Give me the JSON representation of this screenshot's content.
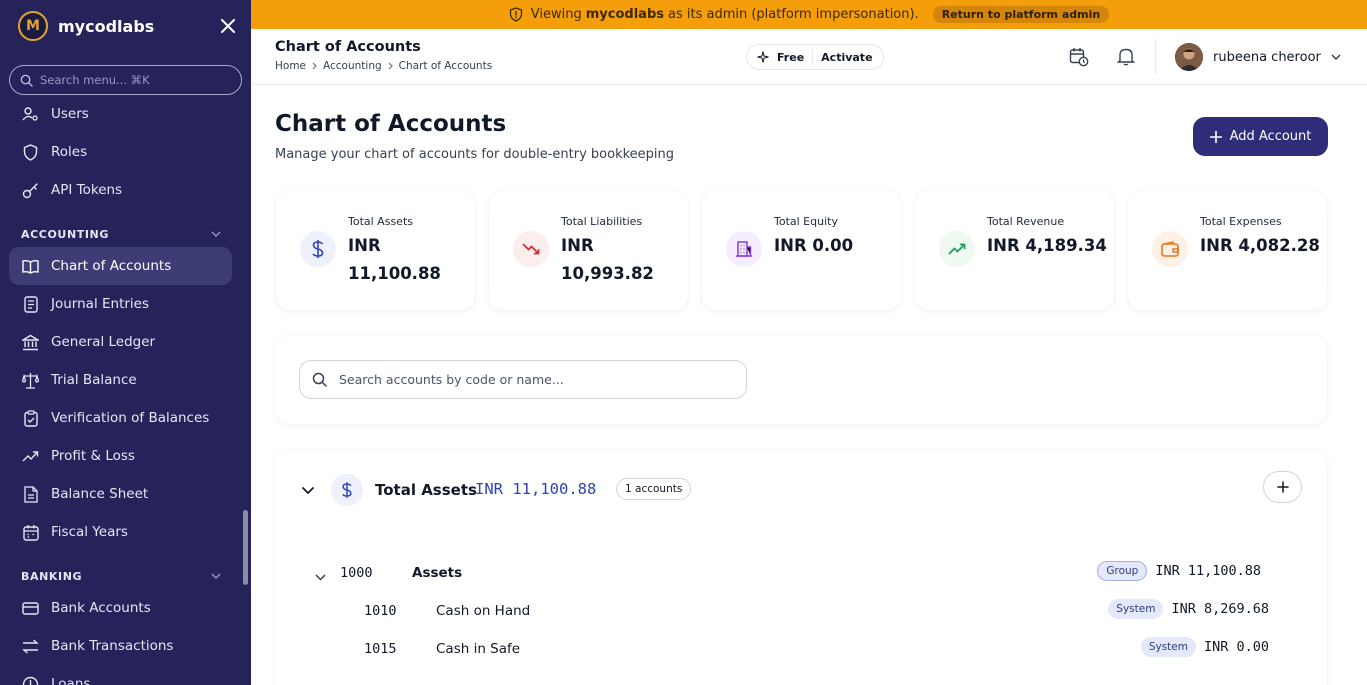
{
  "sidebar": {
    "brand": "mycodlabs",
    "logo_glyph": "M",
    "search_placeholder": "Search menu... ⌘K",
    "items_top": [
      {
        "label": "Users",
        "icon": "user-key-icon"
      },
      {
        "label": "Roles",
        "icon": "shield-icon"
      },
      {
        "label": "API Tokens",
        "icon": "key-icon"
      }
    ],
    "section_accounting": "ACCOUNTING",
    "items_accounting": [
      {
        "label": "Chart of Accounts",
        "icon": "book-open-icon",
        "active": true
      },
      {
        "label": "Journal Entries",
        "icon": "notebook-icon"
      },
      {
        "label": "General Ledger",
        "icon": "bank-icon"
      },
      {
        "label": "Trial Balance",
        "icon": "scale-icon"
      },
      {
        "label": "Verification of Balances",
        "icon": "clipboard-check-icon"
      },
      {
        "label": "Profit & Loss",
        "icon": "trending-up-icon"
      },
      {
        "label": "Balance Sheet",
        "icon": "document-icon"
      },
      {
        "label": "Fiscal Years",
        "icon": "calendar-icon"
      }
    ],
    "section_banking": "BANKING",
    "items_banking": [
      {
        "label": "Bank Accounts",
        "icon": "bank-card-icon"
      },
      {
        "label": "Bank Transactions",
        "icon": "arrows-swap-icon"
      },
      {
        "label": "Loans",
        "icon": "loan-icon"
      }
    ]
  },
  "banner": {
    "prefix": "Viewing",
    "org": "mycodlabs",
    "suffix": "as its admin (platform impersonation).",
    "return_label": "Return to platform admin"
  },
  "header": {
    "title": "Chart of Accounts",
    "breadcrumbs": [
      "Home",
      "Accounting",
      "Chart of Accounts"
    ],
    "plan_label": "Free",
    "plan_action": "Activate",
    "user_name": "rubeena cheroor"
  },
  "page": {
    "title": "Chart of Accounts",
    "subtitle": "Manage your chart of accounts for double-entry bookkeeping",
    "add_button": "Add Account"
  },
  "stats": [
    {
      "label": "Total Assets",
      "value": "INR 11,100.88",
      "icon": "dollar-icon",
      "color": "#2d44b8",
      "bg": "#eef1fb"
    },
    {
      "label": "Total Liabilities",
      "value": "INR 10,993.82",
      "icon": "trending-down-icon",
      "color": "#d12d2d",
      "bg": "#fdeeee"
    },
    {
      "label": "Total Equity",
      "value": "INR 0.00",
      "icon": "building-icon",
      "color": "#8b3fd6",
      "bg": "#f5edfd"
    },
    {
      "label": "Total Revenue",
      "value": "INR 4,189.34",
      "icon": "trending-up-icon",
      "color": "#1f9d55",
      "bg": "#edf9f1"
    },
    {
      "label": "Total Expenses",
      "value": "INR 4,082.28",
      "icon": "wallet-icon",
      "color": "#e8751a",
      "bg": "#fdf1e6"
    }
  ],
  "search": {
    "placeholder": "Search accounts by code or name..."
  },
  "group": {
    "title": "Total Assets",
    "total": "INR 11,100.88",
    "count": "1 accounts"
  },
  "rows": [
    {
      "code": "1000",
      "name": "Assets",
      "tag": "Group",
      "amount": "INR 11,100.88"
    },
    {
      "code": "1010",
      "name": "Cash on Hand",
      "tag": "System",
      "amount": "INR 8,269.68"
    },
    {
      "code": "1015",
      "name": "Cash in Safe",
      "tag": "System",
      "amount": "INR 0.00"
    }
  ]
}
